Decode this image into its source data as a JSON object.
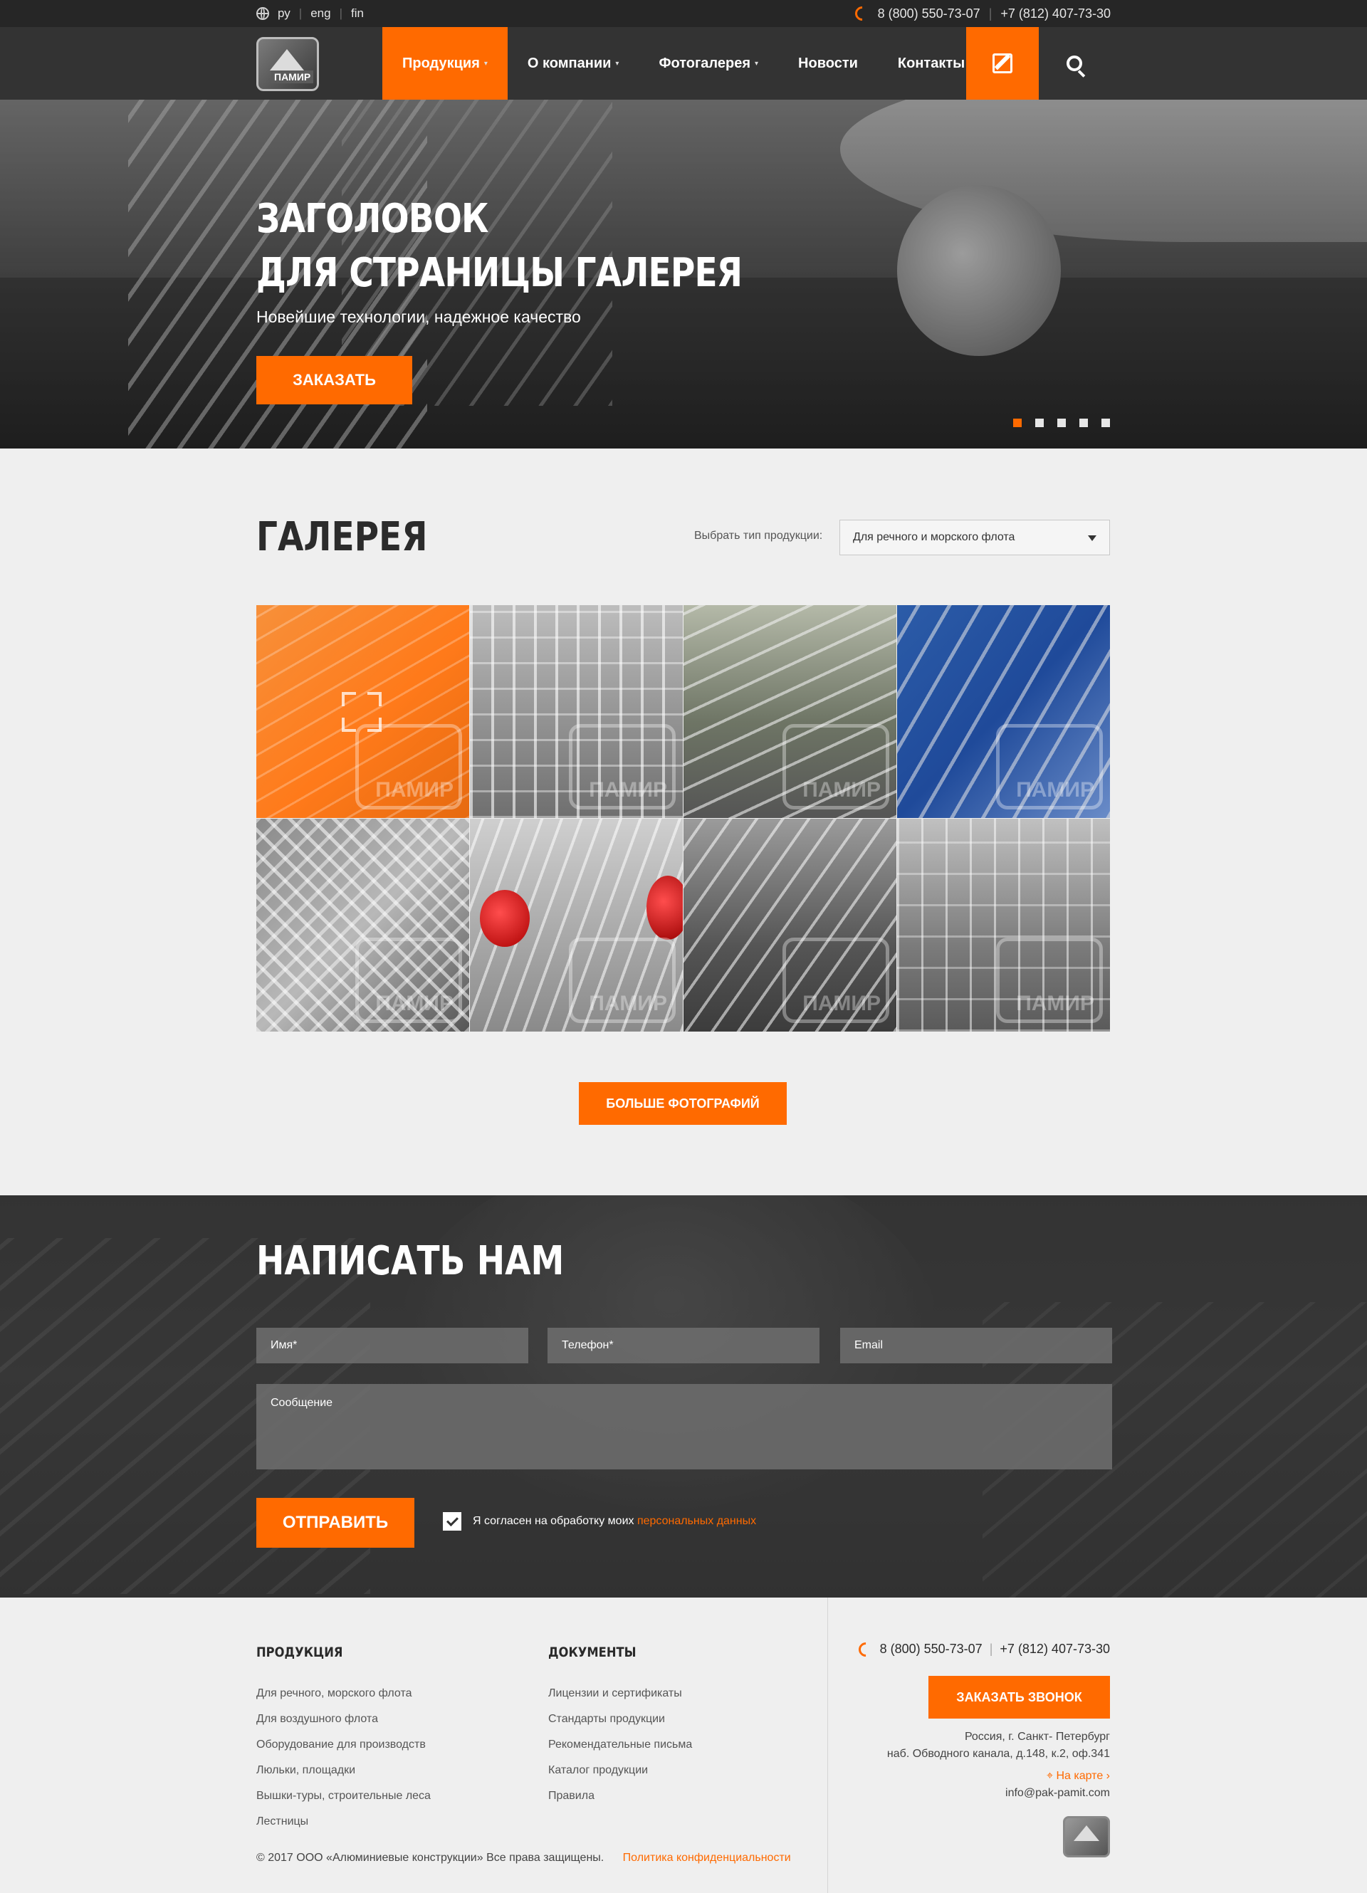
{
  "topbar": {
    "langs": [
      "ру",
      "eng",
      "fin"
    ],
    "phone1": "8 (800) 550-73-07",
    "phone2": "+7 (812) 407-73-30"
  },
  "nav": {
    "logo_text": "ПАМИР",
    "items": [
      {
        "label": "Продукция",
        "caret": true,
        "active": true
      },
      {
        "label": "О компании",
        "caret": true
      },
      {
        "label": "Фотогалерея",
        "caret": true
      },
      {
        "label": "Новости"
      },
      {
        "label": "Контакты"
      }
    ]
  },
  "hero": {
    "title_line1": "ЗАГОЛОВОК",
    "title_line2": "ДЛЯ СТРАНИЦЫ ГАЛЕРЕЯ",
    "subtitle": "Новейшие технологии, надежное качество",
    "button": "ЗАКАЗАТЬ",
    "slides_total": 5,
    "slide_active": 1
  },
  "gallery": {
    "title": "ГАЛЕРЕЯ",
    "filter_label": "Выбрать тип продукции:",
    "filter_value": "Для речного и морского флота",
    "tiles": 8,
    "watermark": "ПАМИР",
    "more_button": "БОЛЬШЕ ФОТОГРАФИЙ"
  },
  "contact": {
    "title": "НАПИСАТЬ НАМ",
    "name_ph": "Имя*",
    "phone_ph": "Телефон*",
    "email_ph": "Email",
    "message_ph": "Сообщение",
    "send": "ОТПРАВИТЬ",
    "agree_text": "Я согласен на обработку моих",
    "agree_link": "персональных данных"
  },
  "footer": {
    "products_title": "ПРОДУКЦИЯ",
    "products": [
      "Для речного, морского флота",
      "Для воздушного флота",
      "Оборудование для производств",
      "Люльки, площадки",
      "Вышки-туры, строительные леса",
      "Лестницы"
    ],
    "docs_title": "ДОКУМЕНТЫ",
    "docs": [
      "Лицензии и сертификаты",
      "Стандарты продукции",
      "Рекомендательные письма",
      "Каталог продукции",
      "Правила"
    ],
    "phone1": "8 (800) 550-73-07",
    "phone2": "+7 (812) 407-73-30",
    "call_button": "ЗАКАЗАТЬ ЗВОНОК",
    "address1": "Россия, г. Санкт- Петербург",
    "address2": "наб. Обводного канала, д.148, к.2, оф.341",
    "map_link": "На карте ›",
    "email": "info@pak-pamit.com",
    "copyright": "© 2017 ООО «Алюминиевые конструкции» Все права защищены.",
    "privacy": "Политика конфиденциальности"
  },
  "colors": {
    "accent": "#ff6a00",
    "dark": "#333333",
    "topbar": "#262626",
    "page_bg": "#efefef"
  }
}
